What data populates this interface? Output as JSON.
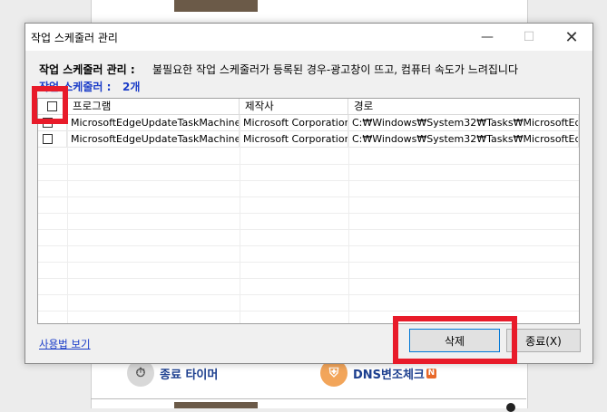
{
  "background": {
    "features": [
      {
        "label": "종료 타이머",
        "icon": "stopwatch-icon"
      },
      {
        "label": "DNS변조체크",
        "icon": "shield-icon",
        "badge": "N"
      }
    ]
  },
  "window": {
    "title": "작업 스케줄러 관리",
    "controls": {
      "minimize": "—",
      "maximize": "☐",
      "close": "✕"
    }
  },
  "info": {
    "label": "작업 스케줄러 관리 :",
    "message": "불필요한 작업 스케줄러가 등록된 경우-광고창이 뜨고, 컴퓨터 속도가 느려집니다"
  },
  "count": {
    "label": "작업 스케줄러 :",
    "value": "2개"
  },
  "table": {
    "columns": [
      "프로그램",
      "제작사",
      "경로"
    ],
    "rows": [
      {
        "program": "MicrosoftEdgeUpdateTaskMachine...",
        "vendor": "Microsoft Corporation",
        "path": "C:₩Windows₩System32₩Tasks₩MicrosoftEd..."
      },
      {
        "program": "MicrosoftEdgeUpdateTaskMachineUA",
        "vendor": "Microsoft Corporation",
        "path": "C:₩Windows₩System32₩Tasks₩MicrosoftEd..."
      }
    ]
  },
  "footer": {
    "help_link": "사용법 보기",
    "delete_button": "삭제",
    "exit_button": "종료(X)"
  },
  "colors": {
    "highlight": "#e81b2a",
    "accent_text": "#1a3cc8"
  }
}
